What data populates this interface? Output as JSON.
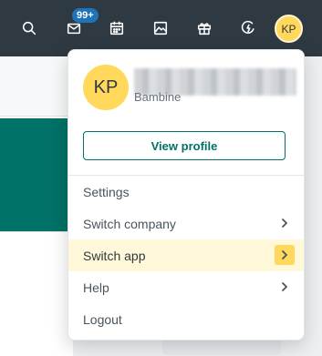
{
  "topbar": {
    "icons": [
      "search-icon",
      "mail-icon",
      "calendar-icon",
      "image-icon",
      "gift-icon",
      "rocket-icon"
    ],
    "mail_badge": "99+",
    "avatar_initials": "KP"
  },
  "dropdown": {
    "avatar_initials": "KP",
    "company": "Bambine",
    "view_profile_label": "View profile",
    "items": [
      {
        "label": "Settings",
        "chevron": false
      },
      {
        "label": "Switch company",
        "chevron": true
      },
      {
        "label": "Switch app",
        "chevron": true,
        "active": true
      },
      {
        "label": "Help",
        "chevron": true
      },
      {
        "label": "Logout",
        "chevron": false
      }
    ]
  },
  "colors": {
    "topbar": "#2f3941",
    "accent_teal": "#007267",
    "avatar_yellow": "#ffd85c",
    "badge_blue": "#1f73b7",
    "highlight": "#fff8d9"
  }
}
